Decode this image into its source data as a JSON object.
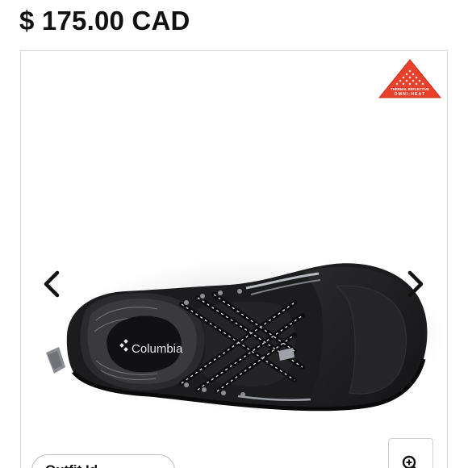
{
  "product": {
    "price": "$ 175.00 CAD"
  },
  "gallery": {
    "badge": {
      "line1": "THERMAL REFLECTIVE",
      "line2": "OMNI-HEAT",
      "color": "#e8402a",
      "icon": "thermal-badge-icon"
    },
    "brand_label": "Columbia",
    "prev_icon": "chevron-left-icon",
    "next_icon": "chevron-right-icon",
    "zoom_icon": "zoom-in-icon",
    "outfit_button_label": "Outfit Id..."
  },
  "colors": {
    "text": "#111111",
    "border": "#d9d9d9",
    "boot": "#1c1c1e"
  }
}
